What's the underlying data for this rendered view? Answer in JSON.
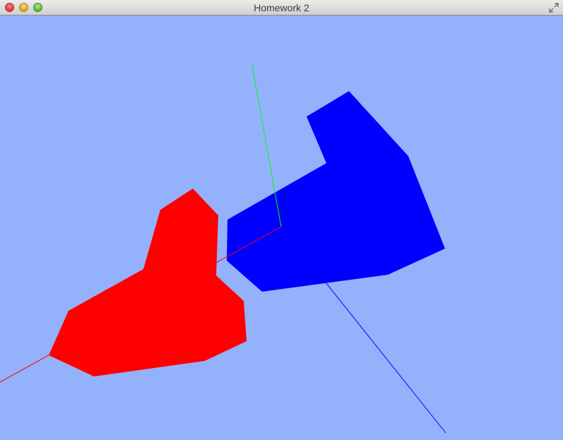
{
  "window": {
    "title": "Homework 2"
  },
  "controls": {
    "close_icon": "close-icon",
    "minimize_icon": "minimize-icon",
    "zoom_icon": "zoom-icon",
    "fullscreen_icon": "fullscreen-icon"
  },
  "scene": {
    "background_color": "#94b1fc",
    "axes": {
      "x_color": "#ff0000",
      "y_color": "#00ff00",
      "z_color": "#0000ff"
    },
    "shapes": {
      "red_color": "#ff0000",
      "blue_color": "#0000ff"
    }
  }
}
